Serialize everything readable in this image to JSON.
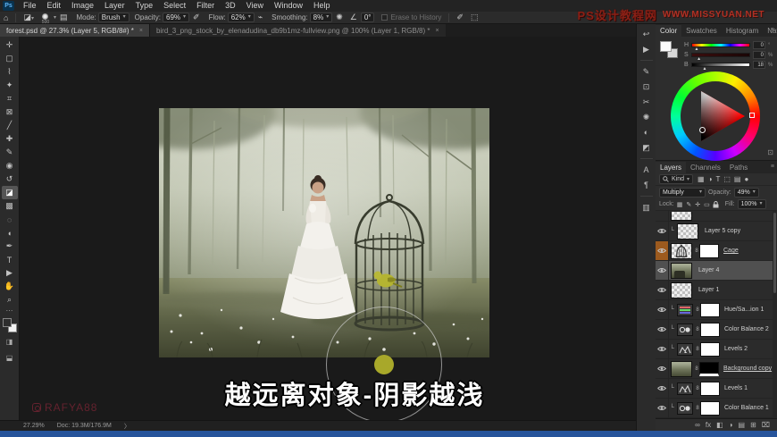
{
  "window": {
    "controls": [
      "–",
      "❐",
      "✕"
    ],
    "site_watermark_cn": "PS设计教程网",
    "site_watermark_url": "WWW.MISSYUAN.NET"
  },
  "menu": {
    "logo": "Ps",
    "items": [
      "File",
      "Edit",
      "Image",
      "Layer",
      "Type",
      "Select",
      "Filter",
      "3D",
      "View",
      "Window",
      "Help"
    ]
  },
  "options_bar": {
    "brush_size": "500",
    "mode_label": "Mode:",
    "mode_value": "Brush",
    "opacity_label": "Opacity:",
    "opacity_value": "69%",
    "flow_label": "Flow:",
    "flow_value": "62%",
    "smoothing_label": "Smoothing:",
    "smoothing_value": "8%",
    "angle_value": "0°",
    "erase_history_label": "Erase to History"
  },
  "tabs": [
    {
      "label": "forest.psd @ 27.3% (Layer 5, RGB/8#) *",
      "active": true
    },
    {
      "label": "bird_3_png_stock_by_elenadudina_db9b1mz-fullview.png @ 100% (Layer 1, RGB/8) *",
      "active": false
    }
  ],
  "toolbar": {
    "tools": [
      {
        "name": "move",
        "glyph": "✛"
      },
      {
        "name": "rectangular-marquee",
        "glyph": "▢"
      },
      {
        "name": "lasso",
        "glyph": "⌇"
      },
      {
        "name": "magic-wand",
        "glyph": "✦"
      },
      {
        "name": "crop",
        "glyph": "⌗"
      },
      {
        "name": "frame",
        "glyph": "⊠"
      },
      {
        "name": "eyedropper",
        "glyph": "╱"
      },
      {
        "name": "spot-healing-brush",
        "glyph": "✚"
      },
      {
        "name": "brush",
        "glyph": "✎"
      },
      {
        "name": "clone-stamp",
        "glyph": "◉"
      },
      {
        "name": "history-brush",
        "glyph": "↺"
      },
      {
        "name": "eraser",
        "glyph": "◪",
        "active": true
      },
      {
        "name": "gradient",
        "glyph": "▩"
      },
      {
        "name": "blur",
        "glyph": "◌"
      },
      {
        "name": "dodge",
        "glyph": "◖"
      },
      {
        "name": "pen",
        "glyph": "✒"
      },
      {
        "name": "type",
        "glyph": "T"
      },
      {
        "name": "path-selection",
        "glyph": "▶"
      },
      {
        "name": "hand",
        "glyph": "✋"
      },
      {
        "name": "zoom",
        "glyph": "⌕"
      }
    ],
    "quick_mask_glyph": "◨",
    "screen_mode_glyph": "⬓"
  },
  "canvas": {
    "subtitle": "越远离对象-阴影越浅",
    "artist_watermark": "RAFYA88"
  },
  "right_strip": {
    "icons": [
      {
        "name": "history",
        "glyph": "↩"
      },
      {
        "name": "actions",
        "glyph": "▶"
      },
      {
        "name": "brush-settings",
        "glyph": "✎"
      },
      {
        "name": "clone-source",
        "glyph": "⊡"
      },
      {
        "name": "snapshot",
        "glyph": "✂"
      },
      {
        "name": "properties",
        "glyph": "✺"
      },
      {
        "name": "adjustments",
        "glyph": "◐"
      },
      {
        "name": "styles",
        "glyph": "◩"
      },
      {
        "name": "character",
        "glyph": "A"
      },
      {
        "name": "paragraph",
        "glyph": "¶"
      },
      {
        "name": "libraries",
        "glyph": "▥"
      }
    ]
  },
  "color_panel": {
    "tabs": [
      "Color",
      "Swatches",
      "Histogram",
      "Navigator"
    ],
    "active_tab": "Color",
    "sliders": [
      {
        "label": "H",
        "value": "0",
        "unit": "°",
        "pos": 4
      },
      {
        "label": "S",
        "value": "0",
        "unit": "%",
        "pos": 8
      },
      {
        "label": "B",
        "value": "18",
        "unit": "%",
        "pos": 18
      }
    ]
  },
  "layers_panel": {
    "tabs": [
      "Layers",
      "Channels",
      "Paths"
    ],
    "active_tab": "Layers",
    "filter_label": "Kind",
    "filter_icons": [
      "▦",
      "◑",
      "T",
      "⬚",
      "▤",
      "●"
    ],
    "blend_mode": "Multiply",
    "opacity_label": "Opacity:",
    "opacity_value": "49%",
    "lock_label": "Lock:",
    "lock_icons": [
      "▦",
      "✎",
      "✛",
      "▭"
    ],
    "fill_label": "Fill:",
    "fill_value": "100%",
    "layers": [
      {
        "name": "",
        "thumb": "checker",
        "partial": true
      },
      {
        "name": "Layer 5 copy",
        "thumb": "checker",
        "clip": true
      },
      {
        "name": "Cage",
        "thumb": "cage",
        "mask": "white",
        "link": true,
        "underline": true,
        "eye_highlight": true
      },
      {
        "name": "Layer 4",
        "thumb": "forest-dark",
        "selected": true
      },
      {
        "name": "Layer 1",
        "thumb": "checker"
      },
      {
        "name": "Hue/Sa...ion 1",
        "icon": "hue",
        "mask": "white",
        "link": true,
        "clip": true
      },
      {
        "name": "Color Balance 2",
        "icon": "balance",
        "mask": "white",
        "link": true,
        "clip": true
      },
      {
        "name": "Levels 2",
        "icon": "levels",
        "mask": "white",
        "link": true,
        "clip": true
      },
      {
        "name": "Background copy",
        "thumb": "forest",
        "mask": "black",
        "link": true,
        "underline": true
      },
      {
        "name": "Levels 1",
        "icon": "levels",
        "mask": "white",
        "link": true,
        "clip": true
      },
      {
        "name": "Color Balance 1",
        "icon": "balance",
        "mask": "white",
        "link": true,
        "clip": true
      }
    ],
    "bottom_icons": [
      {
        "name": "link-layers",
        "glyph": "∞"
      },
      {
        "name": "layer-effects",
        "glyph": "fx"
      },
      {
        "name": "add-layer-mask",
        "glyph": "◧"
      },
      {
        "name": "new-adjustment-layer",
        "glyph": "◑"
      },
      {
        "name": "new-group",
        "glyph": "▤"
      },
      {
        "name": "new-layer",
        "glyph": "⊞"
      },
      {
        "name": "delete-layer",
        "glyph": "⌧"
      }
    ]
  },
  "status_bar": {
    "zoom": "27.29%",
    "doc_info": "Doc: 19.3M/176.9M",
    "chevron": "〉"
  }
}
